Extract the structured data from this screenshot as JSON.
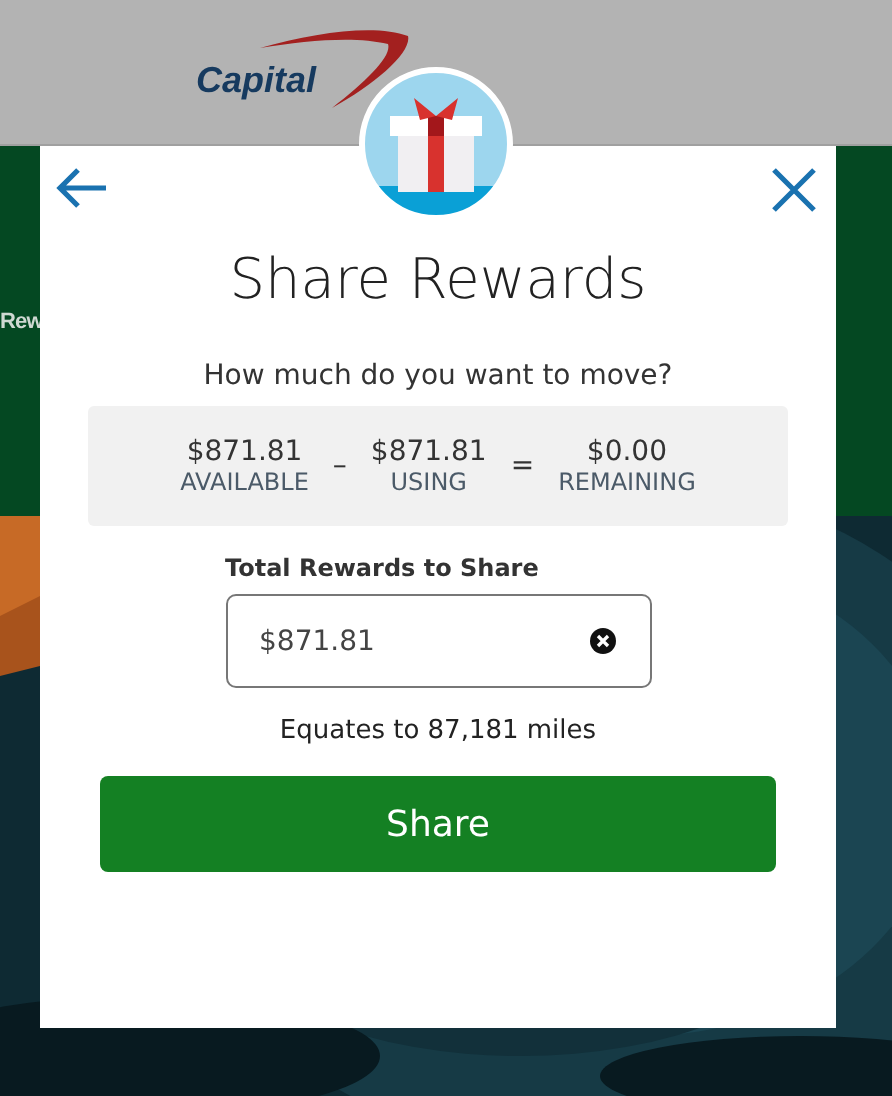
{
  "header": {
    "logo": "Capital"
  },
  "page": {
    "partial_heading": "Rew"
  },
  "dialog": {
    "title": "Share Rewards",
    "question": "How much do you want to move?",
    "summary": [
      {
        "kind": "value",
        "amount": "$871.81",
        "label": "AVAILABLE"
      },
      {
        "kind": "operator",
        "symbol": "–"
      },
      {
        "kind": "value",
        "amount": "$871.81",
        "label": "USING"
      },
      {
        "kind": "operator",
        "symbol": "="
      },
      {
        "kind": "value",
        "amount": "$0.00",
        "label": "REMAINING"
      }
    ],
    "field": {
      "label": "Total Rewards to Share",
      "value": "$871.81"
    },
    "note": "Equates to 87,181 miles",
    "button": "Share"
  }
}
